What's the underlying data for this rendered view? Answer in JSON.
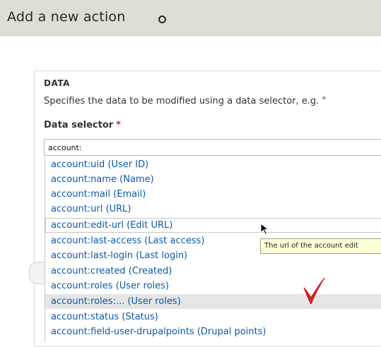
{
  "header": {
    "title": "Add a new action"
  },
  "section": {
    "label": "DATA",
    "description": "Specifies the data to be modified using a data selector, e.g. \""
  },
  "field": {
    "label": "Data selector",
    "required_mark": "*",
    "value": "account:"
  },
  "suggestions": [
    "account:uid (User ID)",
    "account:name (Name)",
    "account:mail (Email)",
    "account:url (URL)",
    "account:edit-url (Edit URL)",
    "account:last-access (Last access)",
    "account:last-login (Last login)",
    "account:created (Created)",
    "account:roles (User roles)",
    "account:roles:... (User roles)",
    "account:status (Status)",
    "account:field-user-drupalpoints (Drupal points)"
  ],
  "tooltip": {
    "text": "The url of the account edit"
  },
  "colors": {
    "header_bg": "#deded6",
    "link": "#0a58ab",
    "required": "#d32a2a",
    "tooltip_bg": "#ffffd7",
    "annotation": "#e02020",
    "highlight": "#e5e5e5"
  }
}
